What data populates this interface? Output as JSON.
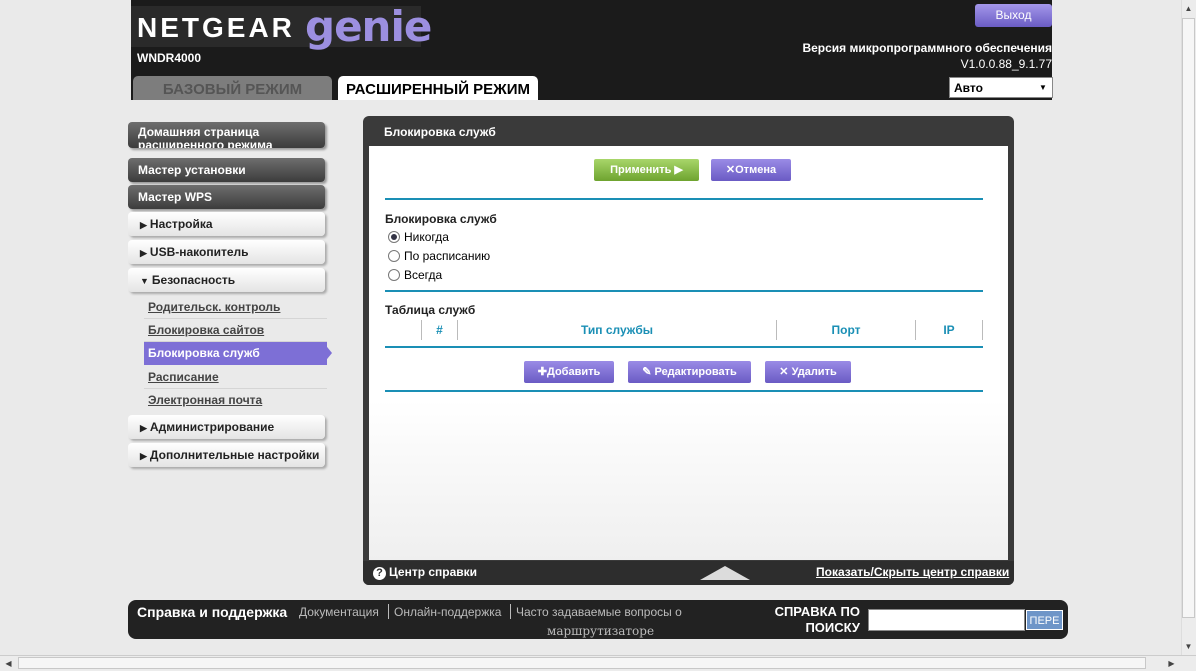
{
  "header": {
    "logo_netgear": "NETGEAR",
    "logo_genie": "genie",
    "model": "WNDR4000",
    "logout_label": "Выход",
    "firmware_label": "Версия микропрограммного обеспечения",
    "firmware_version": "V1.0.0.88_9.1.77",
    "tab_basic": "БАЗОВЫЙ РЕЖИМ",
    "tab_advanced": "РАСШИРЕННЫЙ РЕЖИМ",
    "language_value": "Авто"
  },
  "sidebar": {
    "home": "Домашняя страница расширенного режима",
    "setup_wizard": "Мастер установки",
    "wps_wizard": "Мастер WPS",
    "setup": "Настройка",
    "usb": "USB-накопитель",
    "security": "Безопасность",
    "security_items": [
      "Родительск. контроль",
      "Блокировка сайтов",
      "Блокировка служб",
      "Расписание",
      "Электронная почта"
    ],
    "admin": "Администрирование",
    "advanced_settings": "Дополнительные настройки"
  },
  "main": {
    "title": "Блокировка служб",
    "apply_label": "Применить ▶",
    "cancel_label": "Отмена",
    "section_label": "Блокировка служб",
    "radio_options": [
      "Никогда",
      "По расписанию",
      "Всегда"
    ],
    "selected_option": "Никогда",
    "table_label": "Таблица служб",
    "table_columns": [
      "#",
      "Тип службы",
      "Порт",
      "IP"
    ],
    "add_label": "Добавить",
    "edit_label": "Редактировать",
    "delete_label": "Удалить"
  },
  "help": {
    "center_label": "Центр справки",
    "toggle_label": "Показать/Скрыть центр справки"
  },
  "footer": {
    "title": "Справка и поддержка",
    "links": [
      "Документация",
      "Онлайн-поддержка",
      "Часто задаваемые вопросы о"
    ],
    "link_line2": "маршрутизаторе",
    "search_label": "СПРАВКА ПО ПОИСКУ",
    "go_label": "ПЕРЕ"
  },
  "colors": {
    "accent_purple": "#7d6fd6",
    "apply_green": "#8cc34a",
    "rule_blue": "#1a8fb5"
  }
}
